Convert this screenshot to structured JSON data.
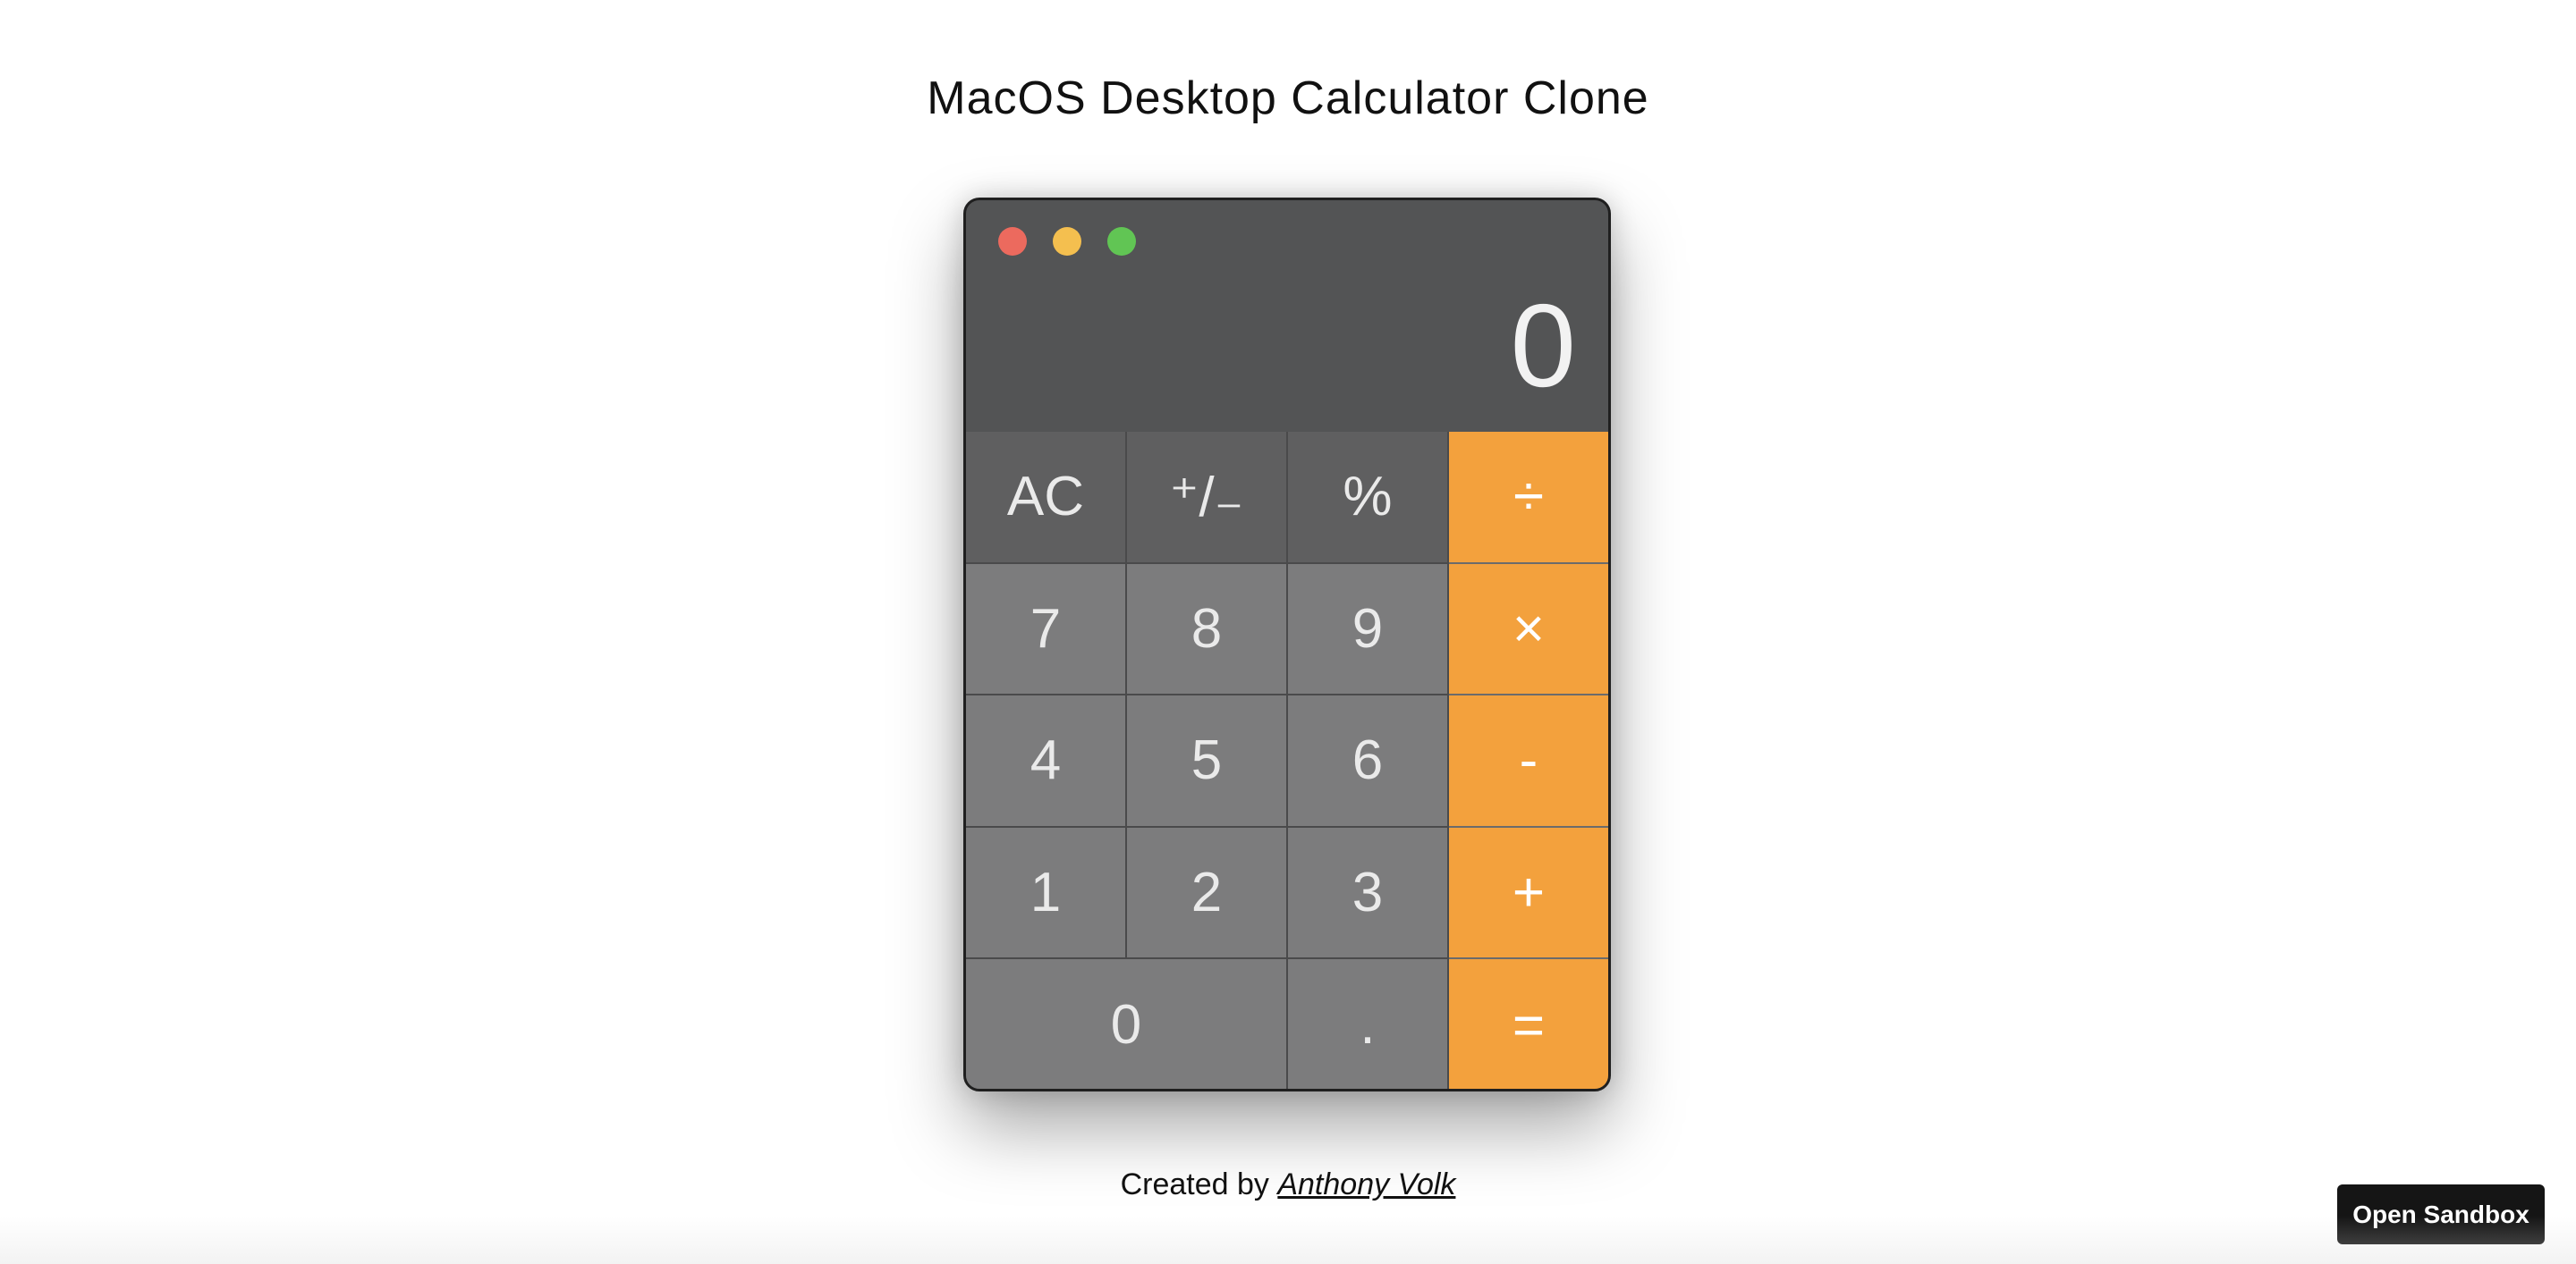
{
  "page": {
    "title": "MacOS Desktop Calculator Clone"
  },
  "calculator": {
    "display_value": "0",
    "window_buttons": {
      "close_color": "#ec6a5e",
      "minimize_color": "#f4bf4f",
      "maximize_color": "#61c554"
    },
    "keys": {
      "ac": "AC",
      "sign": "⁺/₋",
      "percent": "%",
      "divide": "÷",
      "seven": "7",
      "eight": "8",
      "nine": "9",
      "multiply": "×",
      "four": "4",
      "five": "5",
      "six": "6",
      "subtract": "-",
      "one": "1",
      "two": "2",
      "three": "3",
      "add": "+",
      "zero": "0",
      "decimal": ".",
      "equals": "="
    },
    "colors": {
      "body": "#535455",
      "function_key": "#5f5f60",
      "number_key": "#7c7c7d",
      "operator_key": "#f3a13d"
    }
  },
  "footer": {
    "created_by_label": "Created by",
    "author_name": "Anthony Volk"
  },
  "sandbox": {
    "button_label": "Open Sandbox"
  }
}
